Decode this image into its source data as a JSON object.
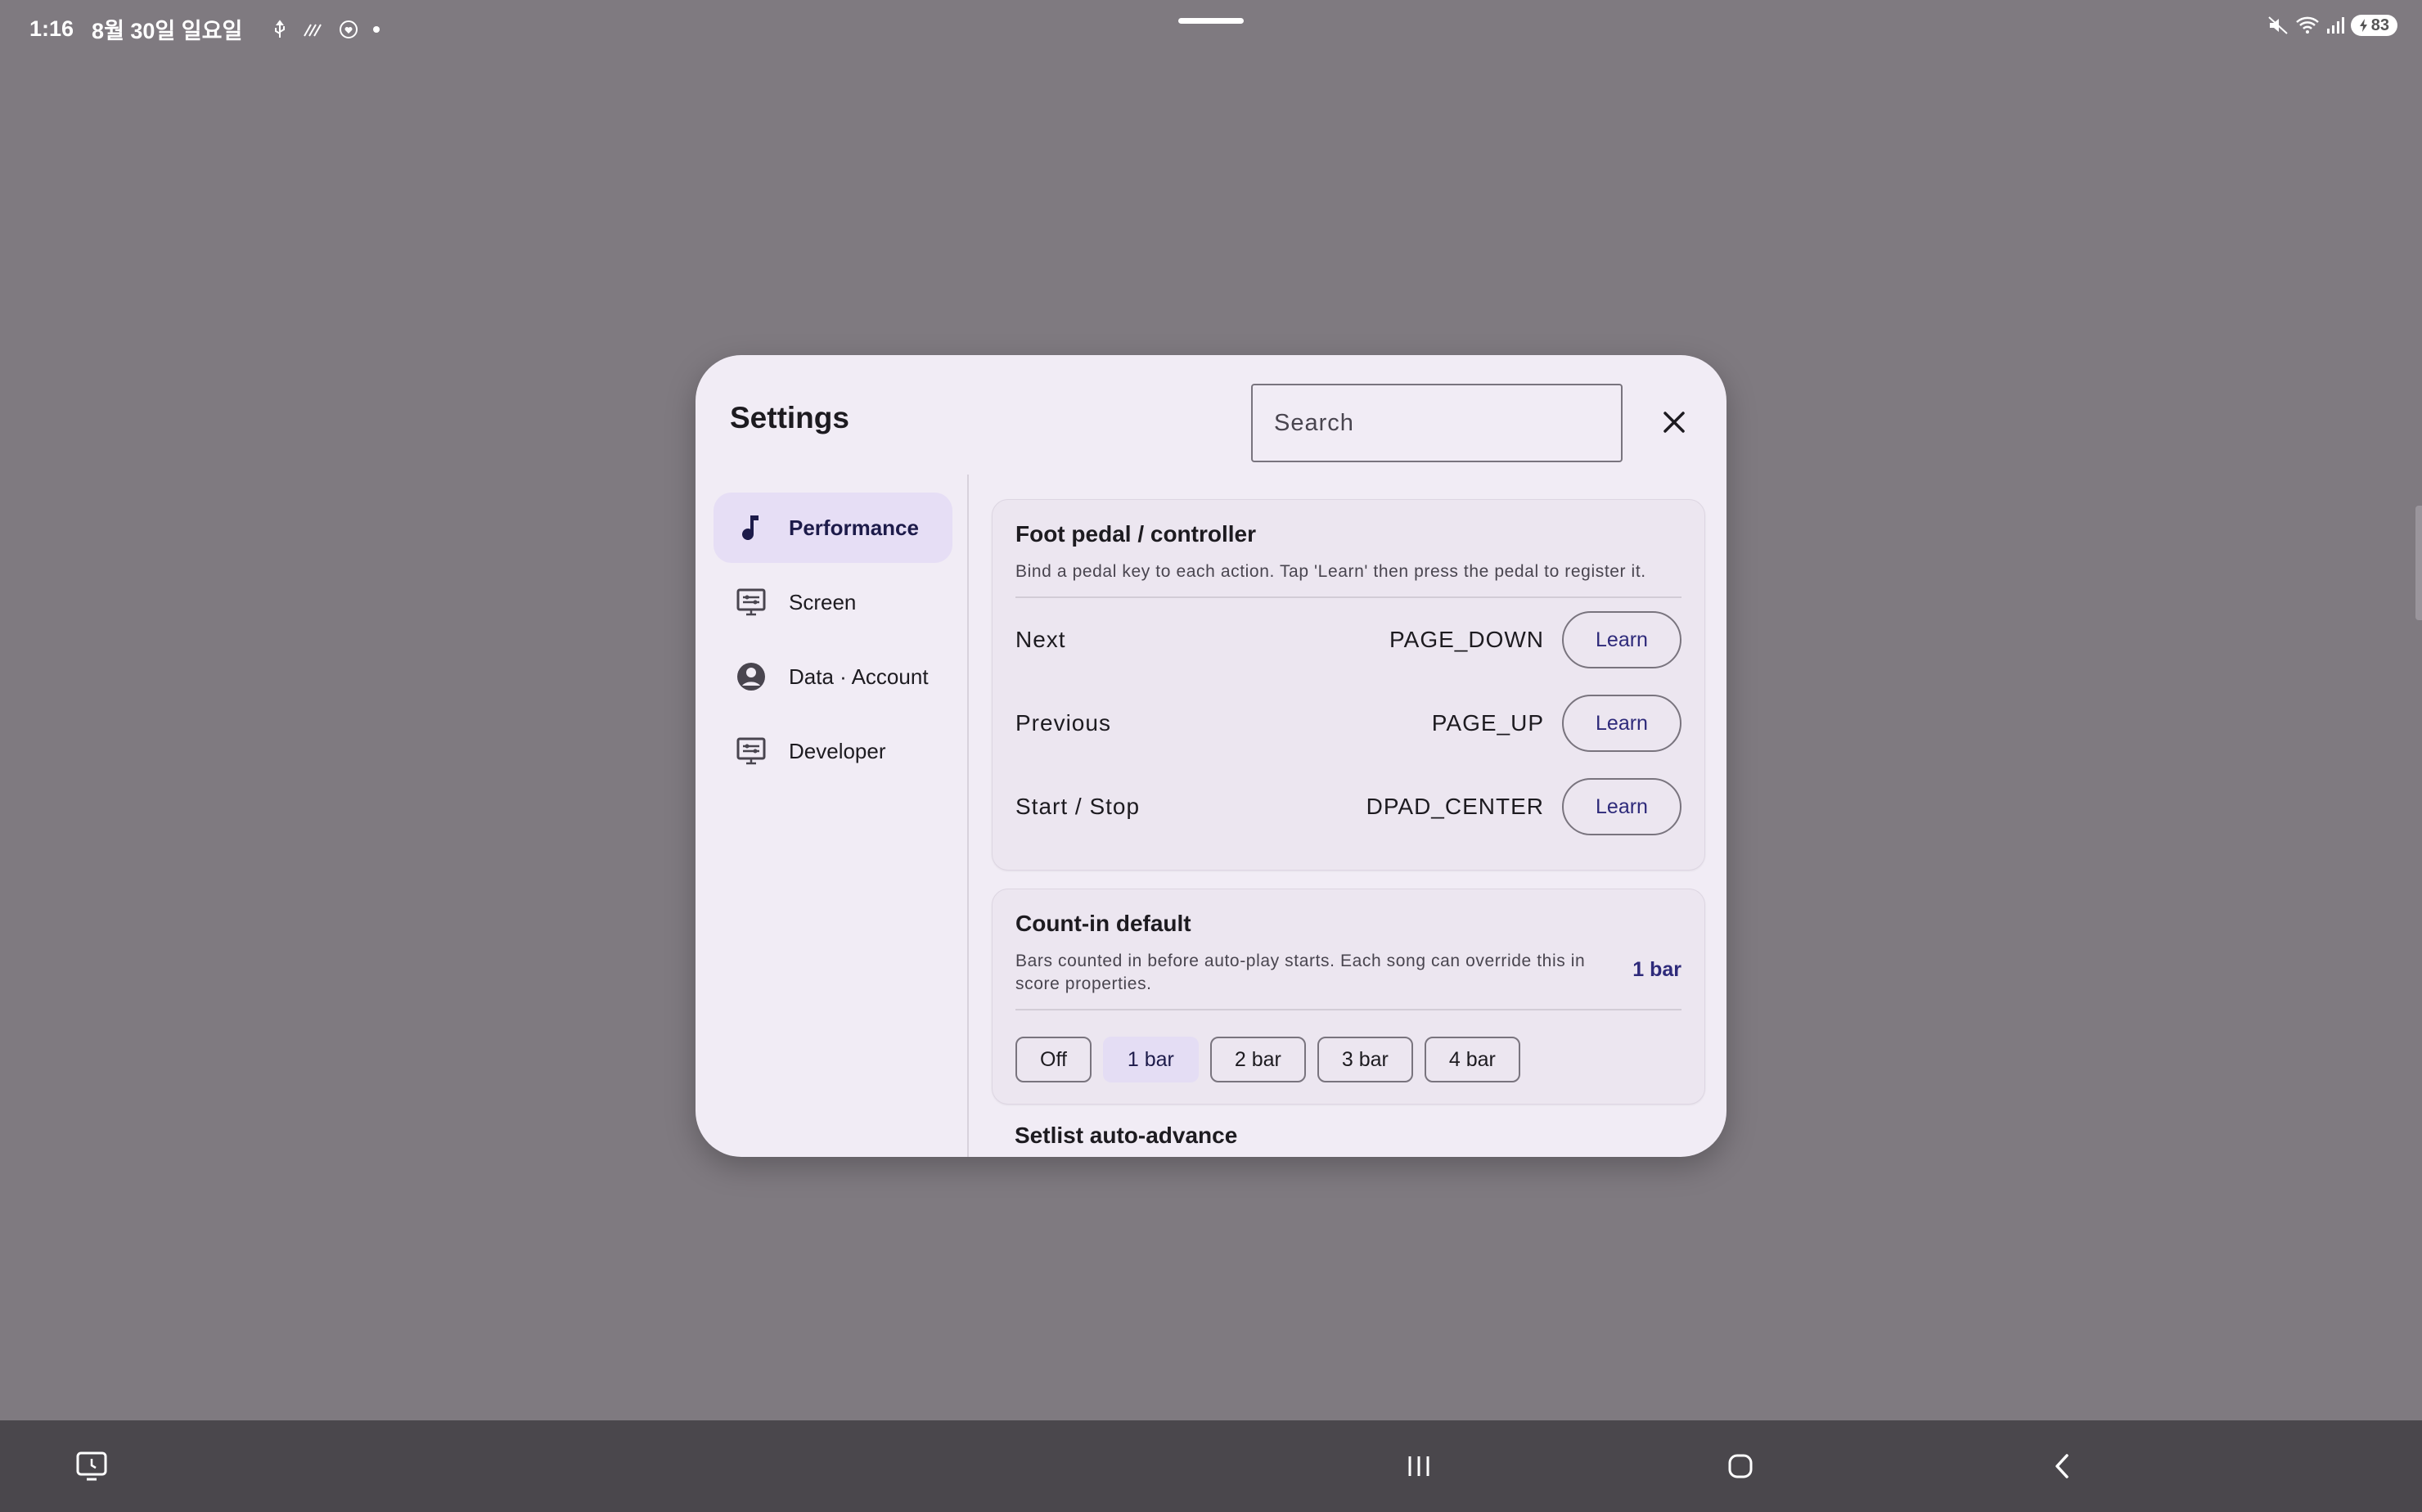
{
  "status_bar": {
    "time": "1:16",
    "date": "8월 30일 일요일",
    "battery": "83"
  },
  "dialog": {
    "title": "Settings",
    "search_placeholder": "Search"
  },
  "sidebar": {
    "items": [
      {
        "label": "Performance",
        "icon": "music-note-icon",
        "active": true
      },
      {
        "label": "Screen",
        "icon": "display-settings-icon",
        "active": false
      },
      {
        "label": "Data · Account",
        "icon": "account-circle-icon",
        "active": false
      },
      {
        "label": "Developer",
        "icon": "display-settings-icon",
        "active": false
      }
    ]
  },
  "foot_pedal": {
    "title": "Foot pedal / controller",
    "description": "Bind a pedal key to each action. Tap 'Learn' then press the pedal to register it.",
    "learn_label": "Learn",
    "bindings": [
      {
        "action": "Next",
        "key": "PAGE_DOWN"
      },
      {
        "action": "Previous",
        "key": "PAGE_UP"
      },
      {
        "action": "Start / Stop",
        "key": "DPAD_CENTER"
      }
    ]
  },
  "count_in": {
    "title": "Count-in default",
    "description": "Bars counted in before auto-play starts. Each song can override this in score properties.",
    "current_value": "1 bar",
    "options": [
      "Off",
      "1 bar",
      "2 bar",
      "3 bar",
      "4 bar"
    ],
    "selected": "1 bar"
  },
  "next_section_peek": "Setlist auto-advance",
  "colors": {
    "backdrop": "#7f7a80",
    "dialog_bg": "#f1ecf5",
    "accent": "#2e2a7a",
    "active_nav": "#e6def5",
    "navbar": "#4a474c"
  }
}
